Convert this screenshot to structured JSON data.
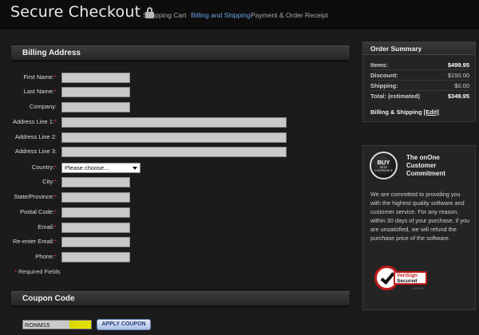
{
  "header": {
    "title": "Secure Checkout",
    "nav": [
      {
        "label": "Shopping Cart",
        "active": false
      },
      {
        "label": "Billing and Shipping",
        "active": true
      },
      {
        "label": "Payment & Order",
        "active": false
      },
      {
        "label": "Receipt",
        "active": false
      }
    ]
  },
  "billing": {
    "heading": "Billing Address",
    "fields": [
      {
        "label": "First Name",
        "required": true,
        "value": ""
      },
      {
        "label": "Last Name",
        "required": true,
        "value": ""
      },
      {
        "label": "Company",
        "required": false,
        "value": ""
      },
      {
        "label": "Address Line 1",
        "required": true,
        "value": ""
      },
      {
        "label": "Address Line 2",
        "required": false,
        "value": ""
      },
      {
        "label": "Address Line 3",
        "required": false,
        "value": ""
      },
      {
        "label": "Country",
        "required": true,
        "value": "Please choose..."
      },
      {
        "label": "City",
        "required": true,
        "value": ""
      },
      {
        "label": "State/Province",
        "required": true,
        "value": ""
      },
      {
        "label": "Postal Code",
        "required": true,
        "value": ""
      },
      {
        "label": "Email",
        "required": true,
        "value": ""
      },
      {
        "label": "Re-enter Email",
        "required": true,
        "value": ""
      },
      {
        "label": "Phone",
        "required": true,
        "value": ""
      }
    ],
    "required_note": "* Required Fields"
  },
  "coupon": {
    "heading": "Coupon Code",
    "value": "RONM15",
    "button": "APPLY COUPON"
  },
  "summary": {
    "heading": "Order Summary",
    "rows": [
      {
        "label": "Items:",
        "value": "$499.95",
        "strong": true
      },
      {
        "label": "Discount:",
        "value": "$150.00",
        "strong": false
      },
      {
        "label": "Shipping:",
        "value": "$0.00",
        "strong": false
      },
      {
        "label": "Total: (estimated)",
        "value": "$349.95",
        "strong": true
      }
    ],
    "billing_shipping_label": "Billing & Shipping",
    "edit_link": "[Edit]"
  },
  "commitment": {
    "badge_line1": "BUY",
    "badge_line2": "WITH CONFIDENCE",
    "title": "The onOne Customer Commitment",
    "body": "We are committed to providing you with the highest quality software and customer service. For any reason, within 30 days of your purchase, if you are unsatisfied, we will refund the purchase price of the software.",
    "verisign_line1": "VeriSign",
    "verisign_line2": "Secured",
    "verisign_line3": "VERIFY"
  },
  "colors": {
    "accent_link": "#6aa4e0",
    "required_star": "#dd3333",
    "background": "#1b1b1b"
  }
}
